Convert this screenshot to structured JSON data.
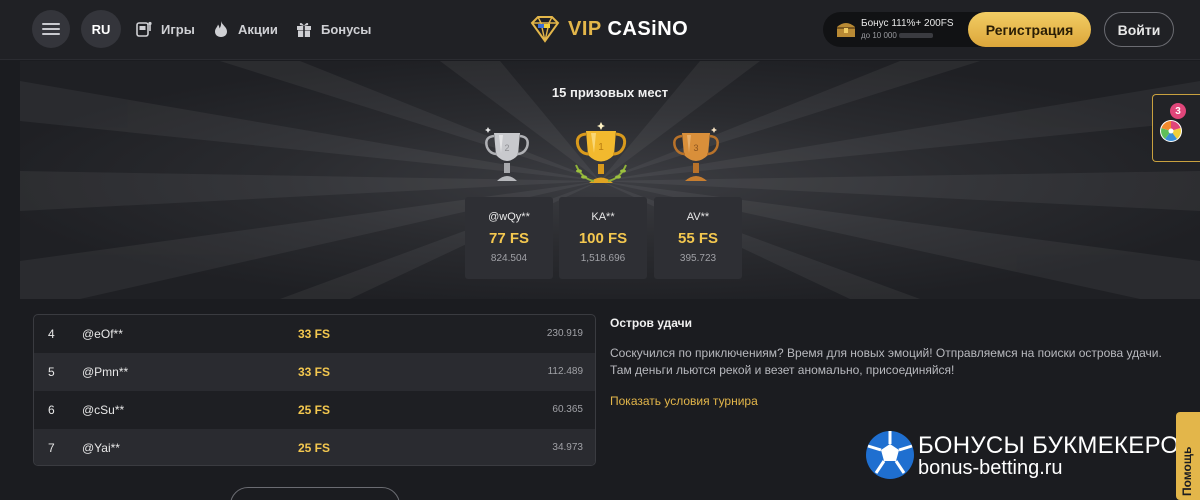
{
  "header": {
    "lang": "RU",
    "nav": [
      {
        "label": "Игры",
        "icon": "slot-machine-icon"
      },
      {
        "label": "Акции",
        "icon": "flame-icon"
      },
      {
        "label": "Бонусы",
        "icon": "gift-icon"
      }
    ],
    "logo": {
      "vip": "VIP",
      "casino": "CASiNO"
    },
    "bonus": {
      "line1": "Бонус 111%+ 200FS",
      "line2": "до 10 000"
    },
    "register_label": "Регистрация",
    "login_label": "Войти"
  },
  "hero": {
    "title": "15 призовых мест",
    "podium": [
      {
        "place": "2",
        "user": "@wQy**",
        "prize": "77 FS",
        "score": "824.504",
        "medal": "silver"
      },
      {
        "place": "1",
        "user": "KA**",
        "prize": "100 FS",
        "score": "1,518.696",
        "medal": "gold"
      },
      {
        "place": "3",
        "user": "AV**",
        "prize": "55 FS",
        "score": "395.723",
        "medal": "bronze"
      }
    ]
  },
  "leaderboard": [
    {
      "place": "4",
      "user": "@eOf**",
      "prize": "33 FS",
      "score": "230.919"
    },
    {
      "place": "5",
      "user": "@Pmn**",
      "prize": "33 FS",
      "score": "112.489"
    },
    {
      "place": "6",
      "user": "@cSu**",
      "prize": "25 FS",
      "score": "60.365"
    },
    {
      "place": "7",
      "user": "@Yai**",
      "prize": "25 FS",
      "score": "34.973"
    }
  ],
  "tournament": {
    "title": "Остров удачи",
    "description": "Соскучился по приключениям? Время для новых эмоций! Отправляемся на поиски острова удачи. Там деньги льются рекой и везет аномально, присоединяйся!",
    "conditions_link": "Показать условия турнира"
  },
  "side_widget": {
    "badge_count": "3"
  },
  "watermark": {
    "line1": "БОНУСЫ БУКМЕКЕРОВ",
    "line2": "bonus-betting.ru"
  },
  "help_tab": {
    "label": "Помощь"
  },
  "colors": {
    "accent_gold": "#e3b64a",
    "prize_gold": "#f4c84f",
    "background": "#1b1c20",
    "header_bg": "#202125",
    "badge_pink": "#e0467a"
  }
}
